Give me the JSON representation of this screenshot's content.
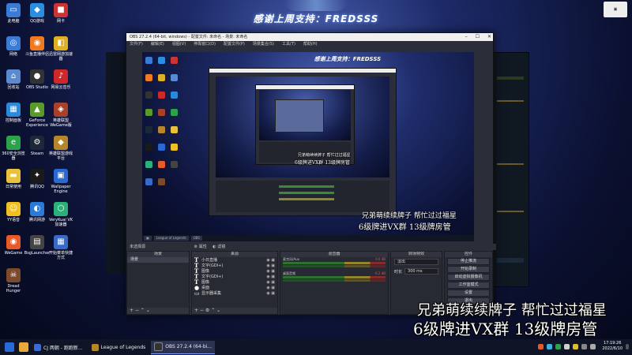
{
  "desktop": {
    "banner": "感谢上周支持：FREDSSS",
    "icons": [
      {
        "label": "此电脑",
        "color": "#3a7bd5",
        "glyph": "▭"
      },
      {
        "label": "QQ游戏",
        "color": "#2a8fe0",
        "glyph": "◆"
      },
      {
        "label": "网卡",
        "color": "#c33",
        "glyph": "■"
      },
      {
        "label": "网络",
        "color": "#3a7bd5",
        "glyph": "◎"
      },
      {
        "label": "斗鱼直播伴侣",
        "color": "#f07a20",
        "glyph": "◉"
      },
      {
        "label": "迅雷网游加速器",
        "color": "#e0b020",
        "glyph": "◧"
      },
      {
        "label": "回收站",
        "color": "#5a8ad0",
        "glyph": "⌂"
      },
      {
        "label": "OBS Studio",
        "color": "#333",
        "glyph": "●"
      },
      {
        "label": "网易云音乐",
        "color": "#d02828",
        "glyph": "♪"
      },
      {
        "label": "控制面板",
        "color": "#2c88d8",
        "glyph": "▦"
      },
      {
        "label": "GeForce Experience",
        "color": "#5a9a2a",
        "glyph": "▲"
      },
      {
        "label": "英雄联盟WeGame版",
        "color": "#a8402a",
        "glyph": "◈"
      },
      {
        "label": "360安全浏览器",
        "color": "#2aa34a",
        "glyph": "e"
      },
      {
        "label": "Steam",
        "color": "#1b2838",
        "glyph": "⚙"
      },
      {
        "label": "英雄联盟游戏平台",
        "color": "#b8862a",
        "glyph": "◆"
      },
      {
        "label": "日常使用",
        "color": "#e8c23a",
        "glyph": "▬"
      },
      {
        "label": "腾讯QQ",
        "color": "#1a1a1a",
        "glyph": "✦"
      },
      {
        "label": "Wallpaper Engine",
        "color": "#2a6ad0",
        "glyph": "▣"
      },
      {
        "label": "YY语音",
        "color": "#f0c020",
        "glyph": "☺"
      },
      {
        "label": "腾讯网游",
        "color": "#2a7ad8",
        "glyph": "◐"
      },
      {
        "label": "VeryKuai VK加速器",
        "color": "#2ab07a",
        "glyph": "⬡"
      },
      {
        "label": "WeGame",
        "color": "#e85a2a",
        "glyph": "◉"
      },
      {
        "label": "BsgLauncher",
        "color": "#444",
        "glyph": "▤"
      },
      {
        "label": "开始菜单快捷方式",
        "color": "#3a6ac8",
        "glyph": "▦"
      },
      {
        "label": "Dread Hunger",
        "color": "#7a4a2a",
        "glyph": "☠"
      }
    ]
  },
  "obs": {
    "title": "OBS 27.2.4 (64-bit, windows) - 配置文件: 未命名 - 场景: 未命名",
    "menu": [
      "文件(F)",
      "编辑(E)",
      "视图(V)",
      "停靠窗口(D)",
      "配置文件(P)",
      "场景集合(S)",
      "工具(T)",
      "帮助(H)"
    ],
    "nested_banner": "感谢上周支持：FREDSSS",
    "no_source_label": "未选择源",
    "props_label": "属性",
    "filters_label": "滤镜",
    "docks": {
      "scenes": {
        "header": "场景",
        "items": [
          "场景"
        ]
      },
      "sources": {
        "header": "来源",
        "items": [
          {
            "type": "T",
            "label": "小日直播"
          },
          {
            "type": "T",
            "label": "文字(GDI+)"
          },
          {
            "type": "T",
            "label": "图像"
          },
          {
            "type": "T",
            "label": "文字(GDI+)"
          },
          {
            "type": "T",
            "label": "图像"
          },
          {
            "type": "●",
            "label": "桌面"
          },
          {
            "type": "▭",
            "label": "显示器采集"
          }
        ]
      },
      "mixer": {
        "header": "混音器",
        "channels": [
          {
            "name": "麦克风/Aux",
            "db": "0.0 dB"
          },
          {
            "name": "桌面音频",
            "db": "-6.2 dB"
          }
        ]
      },
      "transitions": {
        "header": "转场特效",
        "type": "淡出",
        "duration_label": "时长",
        "duration": "300 ms"
      },
      "controls": {
        "header": "控件",
        "buttons": [
          "停止推流",
          "开始录制",
          "启动虚拟摄像机",
          "工作室模式",
          "设置",
          "退出"
        ]
      }
    },
    "preview_caption_1": "兄弟萌续续牌子  帮忙过过福星",
    "preview_caption_2": "6级牌进VX群  13级牌房管",
    "nested_caption_1": "兄弟萌续续牌子  帮忙过过福星",
    "nested_caption_2": "6级牌进VX群  13级牌房管"
  },
  "overlay": {
    "subtitle_1": "兄弟萌续续牌子  帮忙过过福星",
    "subtitle_2": "6级牌进VX群  13级牌房管"
  },
  "taskbar": {
    "apps": [
      {
        "label": "CJ 两朝 - 跑跑新...",
        "color": "#3a6ad8"
      },
      {
        "label": "League of Legends",
        "color": "#b8862a"
      },
      {
        "label": "OBS 27.2.4 (64-bi...",
        "color": "#333"
      }
    ],
    "time": "17:19:26",
    "date": "2022/6/10"
  }
}
